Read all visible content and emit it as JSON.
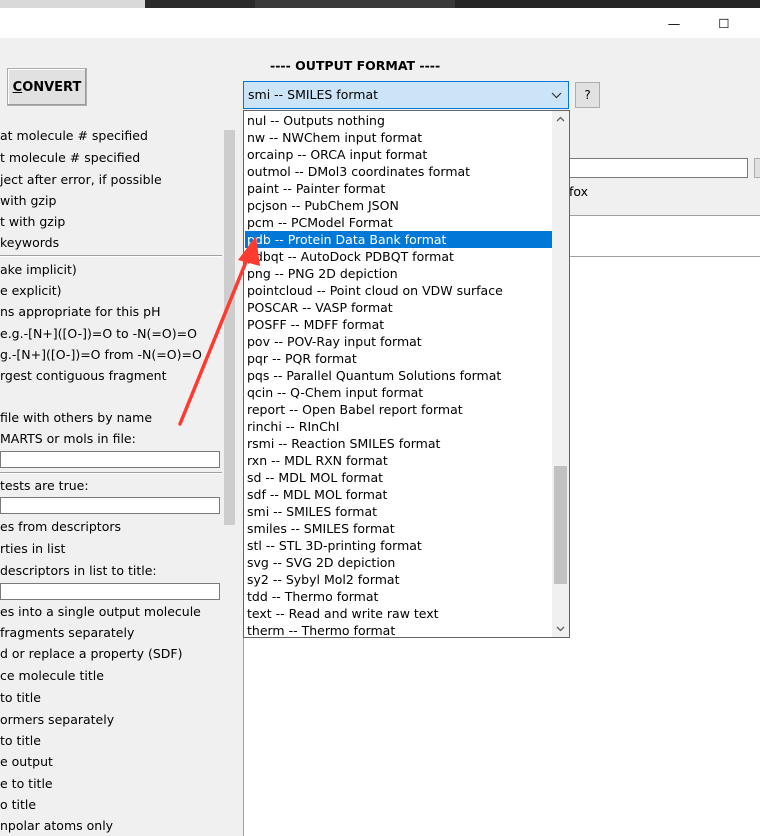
{
  "window": {
    "minimize_glyph": "—",
    "maximize_glyph": "☐"
  },
  "toolbar": {
    "convert_label_first": "C",
    "convert_label_rest": "ONVERT"
  },
  "output_format": {
    "heading": "---- OUTPUT FORMAT ----",
    "selected": "smi -- SMILES format",
    "help_label": "?",
    "options": [
      "nul -- Outputs nothing",
      "nw -- NWChem input format",
      "orcainp -- ORCA input format",
      "outmol -- DMol3 coordinates format",
      "paint -- Painter format",
      "pcjson -- PubChem JSON",
      "pcm -- PCModel Format",
      "pdb -- Protein Data Bank format",
      "pdbqt -- AutoDock PDBQT format",
      "png -- PNG 2D depiction",
      "pointcloud -- Point cloud on VDW surface",
      "POSCAR -- VASP format",
      "POSFF -- MDFF format",
      "pov -- POV-Ray input format",
      "pqr -- PQR format",
      "pqs -- Parallel Quantum Solutions format",
      "qcin -- Q-Chem input format",
      "report -- Open Babel report format",
      "rinchi -- RInChI",
      "rsmi -- Reaction SMILES format",
      "rxn -- MDL RXN format",
      "sd -- MDL MOL format",
      "sdf -- MDL MOL format",
      "smi -- SMILES format",
      "smiles -- SMILES format",
      "stl -- STL 3D-printing format",
      "svg -- SVG 2D depiction",
      "sy2 -- Sybyl Mol2 format",
      "tdd -- Thermo format",
      "text -- Read and write raw text",
      "therm -- Thermo format"
    ],
    "highlighted_index": 7,
    "side_label": "fox"
  },
  "left_options": [
    "at molecule # specified",
    "t molecule # specified",
    "ject after error, if possible",
    " with gzip",
    "t with gzip",
    "keywords",
    "ake implicit)",
    "e explicit)",
    "ns appropriate for this pH",
    " e.g.-[N+]([O-])=O to -N(=O)=O",
    "g.-[N+]([O-])=O from -N(=O)=O",
    "rgest contiguous fragment",
    " file with others by name",
    "MARTS or mols in file:",
    " tests are true:",
    "es from descriptors",
    "rties in list",
    "descriptors in list to title:",
    "es into a single output molecule",
    "fragments separately",
    "d or replace a property (SDF)",
    "ce molecule title",
    "to title",
    "ormers separately",
    " to title",
    "e output",
    "e to title",
    "o title",
    "npolar atoms only"
  ]
}
